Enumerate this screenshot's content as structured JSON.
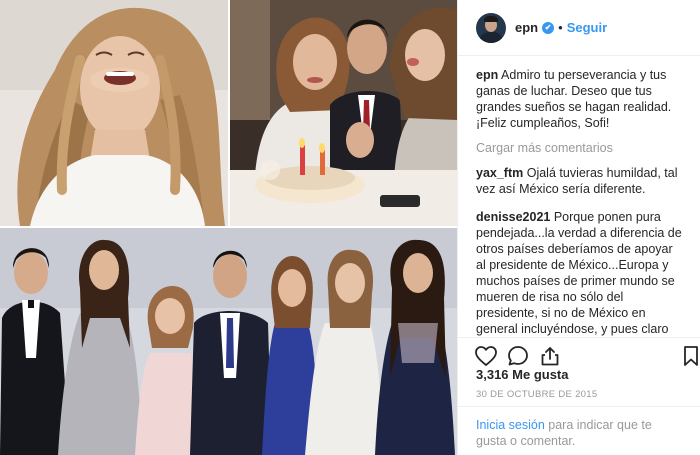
{
  "post": {
    "username": "epn",
    "verified_badge": "✔",
    "separator": "•",
    "follow_label": "Seguir",
    "caption": {
      "username": "epn",
      "text": "Admiro tu perseverancia y tus ganas de luchar. Deseo que tus grandes sueños se hagan realidad. ¡Feliz cumpleaños, Sofi!"
    },
    "load_more_label": "Cargar más comentarios",
    "comments": [
      {
        "username": "yax_ftm",
        "text": "Ojalá tuvieras humildad, tal vez así México sería diferente."
      },
      {
        "username": "denisse2021",
        "text": "Porque ponen pura pendejada...la verdad a diferencia de otros países deberíamos de apoyar al presidente de México...Europa y muchos países de primer mundo se mueren de risa no sólo del presidente, si no de México en general incluyéndose, y pues claro vean las puras pendejadas que ponen sobre nuestro país, y no estoy defendiendo a PEÑA NIETO simplemente sus comentarios carecen de educación en"
      }
    ],
    "likes_label": "3,316 Me gusta",
    "date_label": "30 DE OCTUBRE DE 2015",
    "login": {
      "link_label": "Inicia sesión",
      "rest": " para indicar que te gusta o comentar."
    }
  },
  "icons": {
    "like": "heart-icon",
    "comment": "comment-bubble-icon",
    "share": "share-icon",
    "save": "bookmark-icon",
    "verified": "verified-badge-icon"
  },
  "colors": {
    "link_blue": "#3897f0",
    "text": "#262626",
    "muted": "#999999",
    "divider": "#efefef"
  }
}
